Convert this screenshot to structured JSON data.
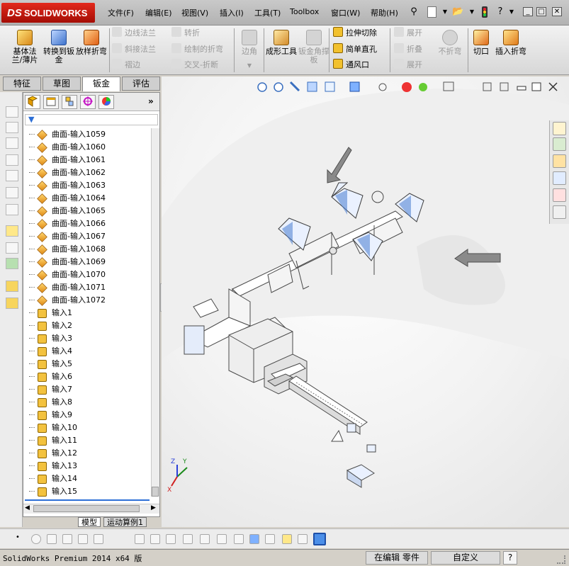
{
  "app": {
    "brand_prefix": "DS",
    "brand_name": "SOLIDWORKS"
  },
  "menu": [
    {
      "id": "file",
      "label": "文件(F)"
    },
    {
      "id": "edit",
      "label": "编辑(E)"
    },
    {
      "id": "view",
      "label": "视图(V)"
    },
    {
      "id": "insert",
      "label": "插入(I)"
    },
    {
      "id": "tools",
      "label": "工具(T)"
    },
    {
      "id": "toolbox",
      "label": "Toolbox"
    },
    {
      "id": "window",
      "label": "窗口(W)"
    },
    {
      "id": "help",
      "label": "帮助(H)"
    }
  ],
  "commands": {
    "base_flange": "基体法兰/薄片",
    "convert_to_sheet": "转换到钣金",
    "lofted_bend": "放样折弯",
    "edge_flange": "边线法兰",
    "miter_flange": "斜接法兰",
    "hem": "褶边",
    "jog": "转折",
    "sketched_bend": "绘制的折弯",
    "cross_break": "交叉-折断",
    "corners": "边角",
    "forming_tool": "成形工具",
    "gusset": "钣金角撑板",
    "extruded_cut": "拉伸切除",
    "simple_hole": "简单直孔",
    "vent": "通风口",
    "unfold": "展开",
    "fold": "折叠",
    "flatten": "展开",
    "no_bends": "不折弯",
    "rip": "切口",
    "insert_bends": "插入折弯"
  },
  "tabs": [
    "特征",
    "草图",
    "钣金",
    "评估"
  ],
  "active_tab": 2,
  "tree_items": [
    {
      "type": "surface",
      "label": "曲面-输入1059"
    },
    {
      "type": "surface",
      "label": "曲面-输入1060"
    },
    {
      "type": "surface",
      "label": "曲面-输入1061"
    },
    {
      "type": "surface",
      "label": "曲面-输入1062"
    },
    {
      "type": "surface",
      "label": "曲面-输入1063"
    },
    {
      "type": "surface",
      "label": "曲面-输入1064"
    },
    {
      "type": "surface",
      "label": "曲面-输入1065"
    },
    {
      "type": "surface",
      "label": "曲面-输入1066"
    },
    {
      "type": "surface",
      "label": "曲面-输入1067"
    },
    {
      "type": "surface",
      "label": "曲面-输入1068"
    },
    {
      "type": "surface",
      "label": "曲面-输入1069"
    },
    {
      "type": "surface",
      "label": "曲面-输入1070"
    },
    {
      "type": "surface",
      "label": "曲面-输入1071"
    },
    {
      "type": "surface",
      "label": "曲面-输入1072"
    },
    {
      "type": "input",
      "label": "输入1"
    },
    {
      "type": "input",
      "label": "输入2"
    },
    {
      "type": "input",
      "label": "输入3"
    },
    {
      "type": "input",
      "label": "输入4"
    },
    {
      "type": "input",
      "label": "输入5"
    },
    {
      "type": "input",
      "label": "输入6"
    },
    {
      "type": "input",
      "label": "输入7"
    },
    {
      "type": "input",
      "label": "输入8"
    },
    {
      "type": "input",
      "label": "输入9"
    },
    {
      "type": "input",
      "label": "输入10"
    },
    {
      "type": "input",
      "label": "输入11"
    },
    {
      "type": "input",
      "label": "输入12"
    },
    {
      "type": "input",
      "label": "输入13"
    },
    {
      "type": "input",
      "label": "输入14"
    },
    {
      "type": "input",
      "label": "输入15"
    }
  ],
  "bottom_tabs": [
    "模型",
    "运动算例1"
  ],
  "status": {
    "product": "SolidWorks Premium 2014 x64 版",
    "mode": "在编辑 零件",
    "units": "自定义",
    "help": "?"
  },
  "triad": {
    "x": "X",
    "y": "Y",
    "z": "Z"
  },
  "colors": {
    "brand_red": "#c8170b",
    "highlight_blue": "#2d6fd6",
    "surface_orange": "#e08a16"
  }
}
